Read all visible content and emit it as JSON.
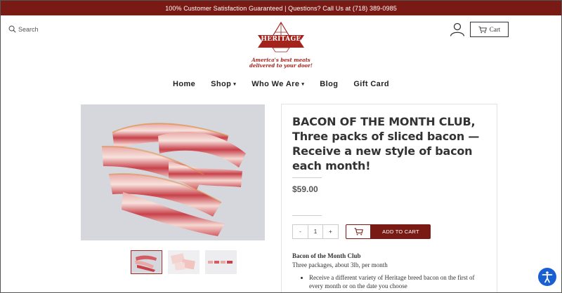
{
  "announcement": "100% Customer Satisfaction Guaranteed | Questions? Call Us at (718) 389-0985",
  "search": {
    "label": "Search"
  },
  "logo": {
    "word": "HERITAGE",
    "sub": "Foods",
    "tagline_1": "America's best meats",
    "tagline_2": "delivered to your door!"
  },
  "cart": {
    "label": "Cart"
  },
  "nav": {
    "items": [
      {
        "label": "Home"
      },
      {
        "label": "Shop",
        "caret": "▾"
      },
      {
        "label": "Who We Are",
        "caret": "▾"
      },
      {
        "label": "Blog"
      },
      {
        "label": "Gift Card"
      }
    ]
  },
  "product": {
    "title": "BACON OF THE MONTH CLUB, Three packs of sliced bacon — Receive a new style of bacon each month!",
    "price": "$59.00",
    "quantity": {
      "minus": "-",
      "value": "1",
      "plus": "+"
    },
    "add_to_cart": "ADD TO CART",
    "desc_title": "Bacon of the Month Club",
    "desc_sub": "Three packages, about 3lb, per month",
    "bullets": [
      "Receive a different variety of Heritage breed bacon on the first of every month or on the date you choose"
    ]
  },
  "colors": {
    "brand": "#7a1a14",
    "accent_red": "#a3231d",
    "accessibility_blue": "#1a5fd1"
  },
  "icons": [
    "search-icon",
    "account-icon",
    "cart-icon",
    "accessibility-icon"
  ]
}
